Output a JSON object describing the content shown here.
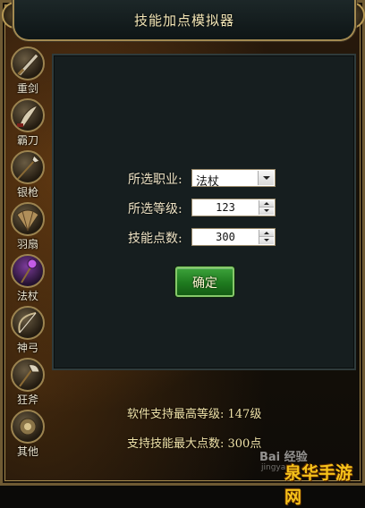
{
  "window": {
    "title": "技能加点模拟器"
  },
  "sidebar": {
    "items": [
      {
        "label": "重剑",
        "icon": "greatsword-icon"
      },
      {
        "label": "霸刀",
        "icon": "blade-icon"
      },
      {
        "label": "银枪",
        "icon": "spear-icon"
      },
      {
        "label": "羽扇",
        "icon": "fan-icon"
      },
      {
        "label": "法杖",
        "icon": "staff-icon"
      },
      {
        "label": "神弓",
        "icon": "bow-icon"
      },
      {
        "label": "狂斧",
        "icon": "axe-icon"
      },
      {
        "label": "其他",
        "icon": "misc-icon"
      }
    ]
  },
  "form": {
    "class_label": "所选职业:",
    "class_value": "法杖",
    "level_label": "所选等级:",
    "level_value": "123",
    "points_label": "技能点数:",
    "points_value": "300",
    "confirm_label": "确定"
  },
  "info": {
    "max_level": "软件支持最高等级: 147级",
    "max_points": "支持技能最大点数: 300点"
  },
  "watermark": {
    "baidu": "Bai 经验",
    "baidu_sub": "jingyan",
    "site": "泉华手游网"
  },
  "colors": {
    "accent_gold": "#a38a51",
    "panel_bg": "#161e1f",
    "confirm_green": "#1f7a1f",
    "text_cream": "#efe4c6"
  }
}
